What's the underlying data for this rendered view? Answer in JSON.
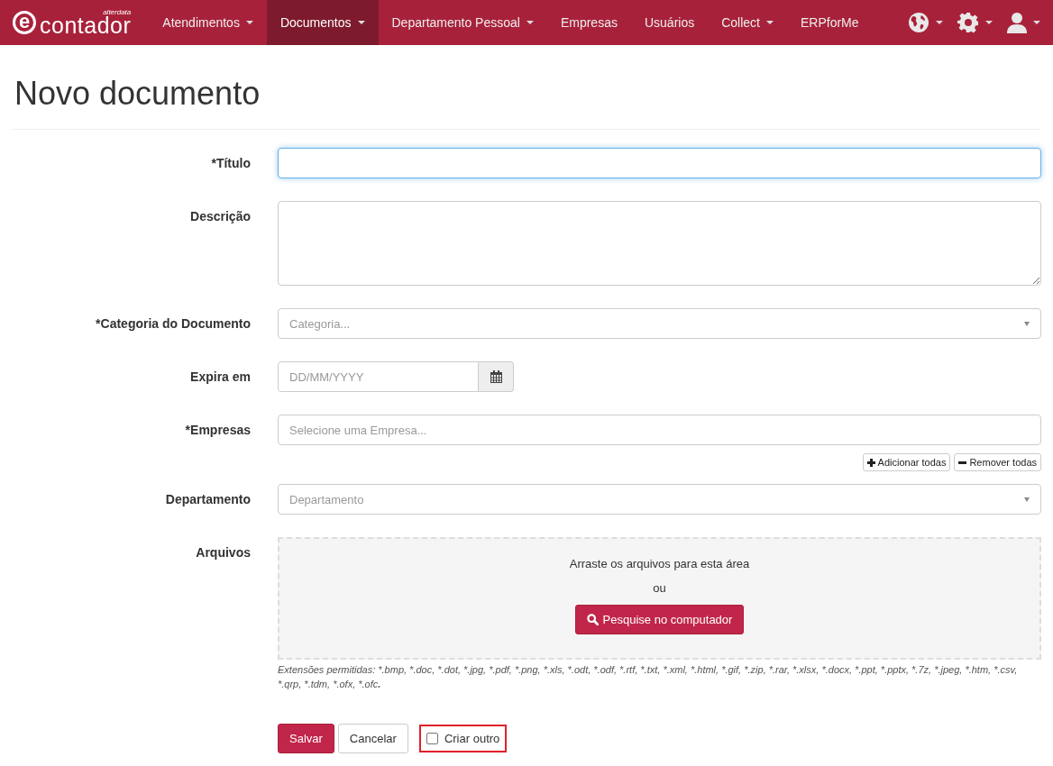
{
  "navbar": {
    "logo": {
      "mark": "e",
      "name": "contador",
      "brand": "alterdata"
    },
    "items": [
      {
        "label": "Atendimentos",
        "dropdown": true,
        "selected": false
      },
      {
        "label": "Documentos",
        "dropdown": true,
        "selected": true
      },
      {
        "label": "Departamento Pessoal",
        "dropdown": true,
        "selected": false
      },
      {
        "label": "Empresas",
        "dropdown": false,
        "selected": false
      },
      {
        "label": "Usuários",
        "dropdown": false,
        "selected": false
      },
      {
        "label": "Collect",
        "dropdown": true,
        "selected": false
      },
      {
        "label": "ERPforMe",
        "dropdown": false,
        "selected": false
      }
    ],
    "icons": [
      {
        "kind": "globe"
      },
      {
        "kind": "gear"
      },
      {
        "kind": "user"
      }
    ]
  },
  "page_title": "Novo documento",
  "form": {
    "fields": [
      {
        "kind": "text",
        "label": "*Título",
        "focused": true
      },
      {
        "kind": "textarea",
        "label": "Descrição"
      },
      {
        "kind": "select",
        "label": "*Categoria do Documento",
        "placeholder": "Categoria..."
      },
      {
        "kind": "date",
        "label": "Expira em",
        "placeholder": "DD/MM/YYYY"
      },
      {
        "kind": "multi",
        "label": "*Empresas",
        "placeholder": "Selecione uma Empresa...",
        "buttons": [
          {
            "kind": "add",
            "label": "Adicionar todas"
          },
          {
            "kind": "remove",
            "label": "Remover todas"
          }
        ]
      },
      {
        "kind": "select",
        "label": "Departamento",
        "placeholder": "Departamento"
      },
      {
        "kind": "files",
        "label": "Arquivos",
        "drop_text": "Arraste os arquivos para esta área",
        "or_text": "ou",
        "button": "Pesquise no computador",
        "extensions": "Extensões permitidas: *.bmp, *.doc, *.dot, *.jpg, *.pdf, *.png, *.xls, *.odt, *.odf, *.rtf, *.txt, *.xml, *.html, *.gif, *.zip, *.rar, *.xlsx, *.docx, *.ppt, *.pptx, *.7z, *.jpeg, *.htm, *.csv, *.qrp, *.tdm, *.ofx, *.ofc**.**"
      }
    ],
    "actions": {
      "save": "Salvar",
      "cancel": "Cancelar",
      "another": {
        "label": "Criar outro",
        "checked": false,
        "highlighted": true
      }
    }
  }
}
